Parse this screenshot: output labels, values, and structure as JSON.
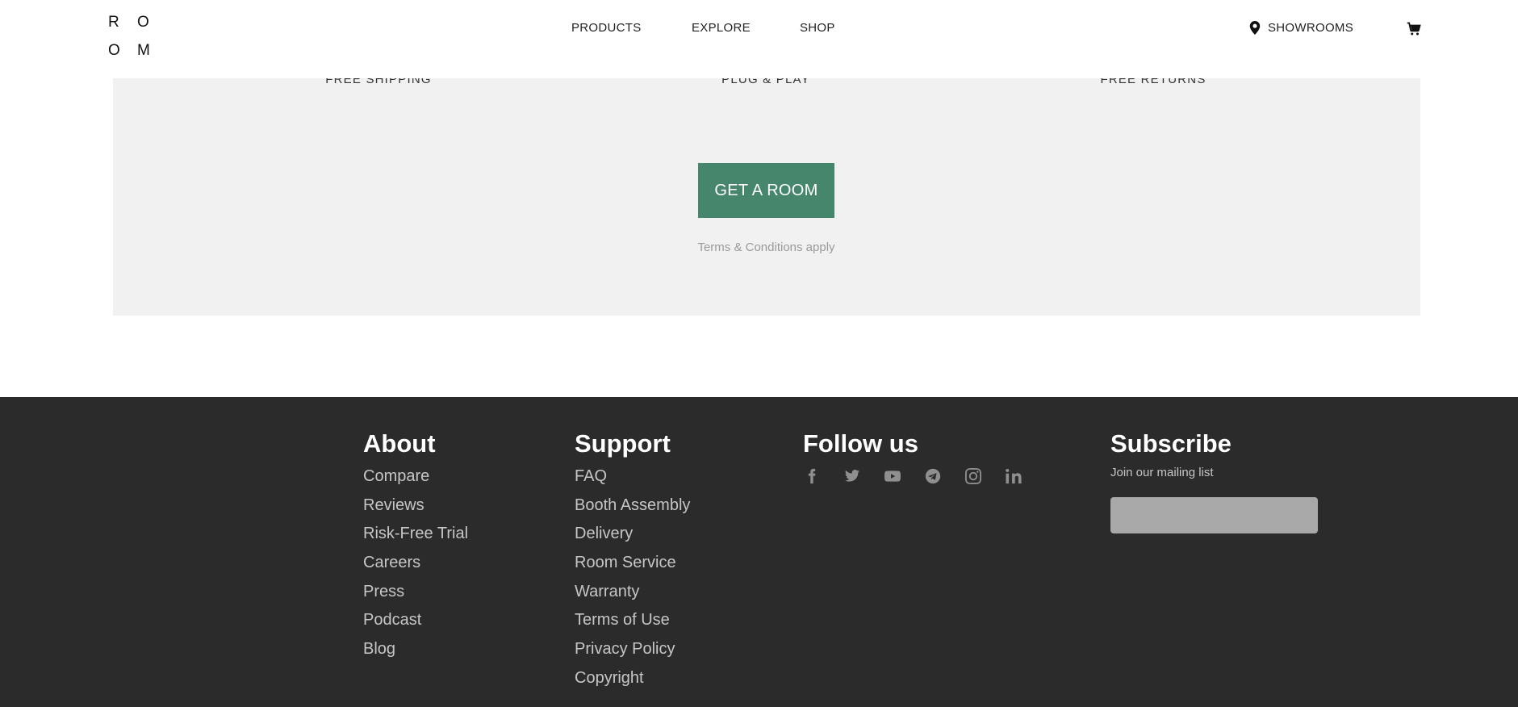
{
  "header": {
    "logo_letters": [
      "R",
      "O",
      "O",
      "M"
    ],
    "nav": [
      "PRODUCTS",
      "EXPLORE",
      "SHOP"
    ],
    "showrooms": "SHOWROOMS"
  },
  "promo": {
    "features": [
      "FREE SHIPPING",
      "PLUG & PLAY",
      "FREE RETURNS"
    ],
    "cta": "GET A ROOM",
    "terms": "Terms & Conditions apply",
    "cta_color": "#46866d"
  },
  "footer": {
    "about": {
      "title": "About",
      "links": [
        "Compare",
        "Reviews",
        "Risk-Free Trial",
        "Careers",
        "Press",
        "Podcast",
        "Blog"
      ]
    },
    "support": {
      "title": "Support",
      "links": [
        "FAQ",
        "Booth Assembly",
        "Delivery",
        "Room Service",
        "Warranty",
        "Terms of Use",
        "Privacy Policy",
        "Copyright"
      ]
    },
    "follow": {
      "title": "Follow us",
      "icons": [
        "facebook-icon",
        "twitter-icon",
        "youtube-icon",
        "telegram-icon",
        "instagram-icon",
        "linkedin-icon"
      ]
    },
    "subscribe": {
      "title": "Subscribe",
      "text": "Join our mailing list",
      "placeholder": ""
    }
  }
}
